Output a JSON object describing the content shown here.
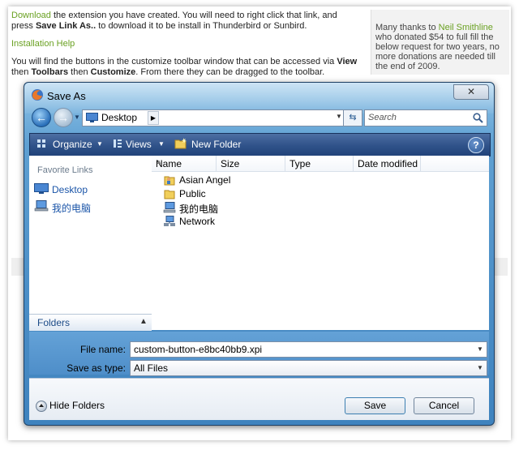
{
  "web_page": {
    "para1": {
      "link": "Download",
      "text1": " the extension you have created. You will need to right click that link, and press ",
      "bold": "Save Link As..",
      "text2": " to download it to be install in Thunderbird or Sunbird."
    },
    "install_help": "Installation Help",
    "para2": {
      "text1": "You will find the buttons in the customize toolbar window that can be accessed via ",
      "bold1": "View",
      "text2": " then ",
      "bold2": "Toolbars",
      "text3": " then ",
      "bold3": "Customize",
      "text4": ". From there they can be dragged to the toolbar."
    },
    "sidebar": {
      "prefix": "Many thanks to ",
      "link": "Neil Smithline",
      "text": " who donated $54 to full fill the below request for two years, no more donations are needed till the end of 2009."
    }
  },
  "dialog": {
    "title": "Save As",
    "close_label": "✕",
    "address": {
      "location": "Desktop"
    },
    "search": {
      "placeholder": "Search"
    },
    "toolbar": {
      "organize": "Organize",
      "views": "Views",
      "new_folder": "New Folder",
      "help": "?"
    },
    "favorite_links": {
      "title": "Favorite Links",
      "items": [
        {
          "label": "Desktop",
          "icon": "desktop-icon"
        },
        {
          "label": "我的电脑",
          "icon": "computer-icon"
        }
      ]
    },
    "folders_label": "Folders",
    "columns": [
      "Name",
      "Size",
      "Type",
      "Date modified"
    ],
    "files": [
      {
        "name": "Asian Angel",
        "icon": "user-folder-icon"
      },
      {
        "name": "Public",
        "icon": "folder-icon"
      },
      {
        "name": "我的电脑",
        "icon": "computer-icon"
      },
      {
        "name": "Network",
        "icon": "network-icon"
      }
    ],
    "file_name": {
      "label": "File name:",
      "value": "custom-button-e8bc40bb9.xpi"
    },
    "save_as_type": {
      "label": "Save as type:",
      "value": "All Files"
    },
    "hide_folders": "Hide Folders",
    "save_label": "Save",
    "cancel_label": "Cancel"
  }
}
